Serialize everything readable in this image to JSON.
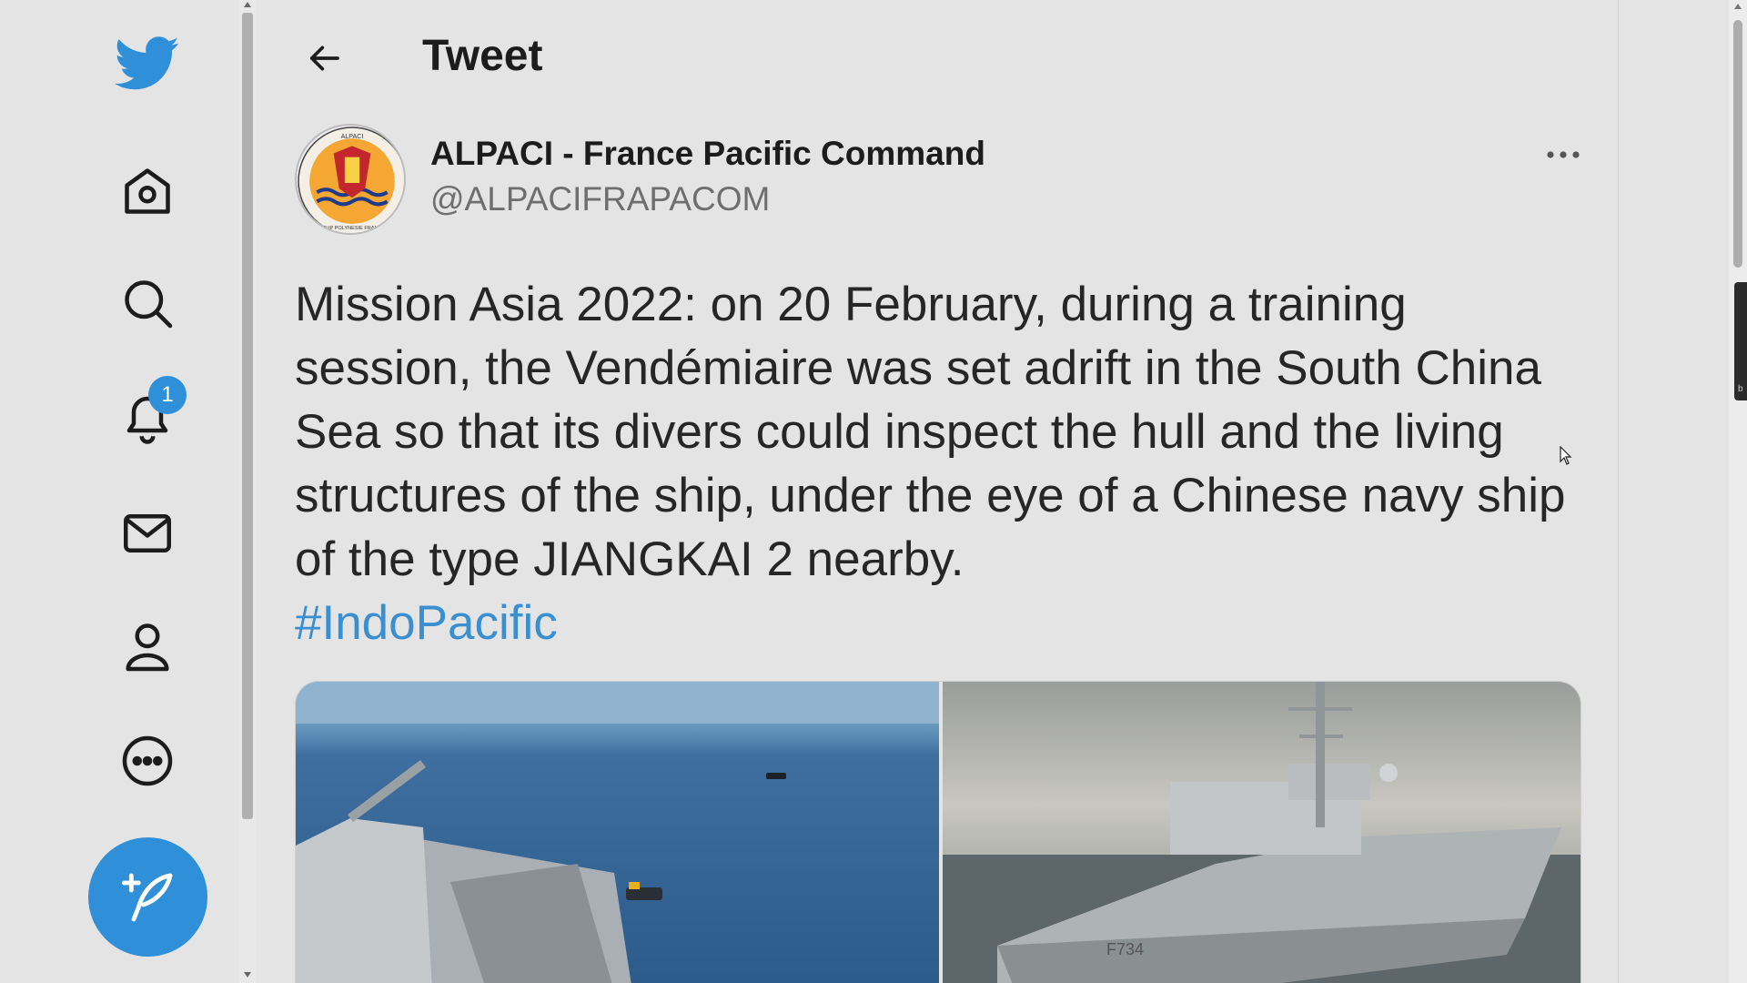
{
  "colors": {
    "accent": "#2f8fd8",
    "hashtag": "#3a8fd0",
    "background": "#e4e4e4"
  },
  "nav": {
    "items": [
      {
        "name": "twitter-logo",
        "icon": "twitter-bird-icon"
      },
      {
        "name": "home",
        "icon": "home-icon"
      },
      {
        "name": "explore",
        "icon": "search-icon"
      },
      {
        "name": "notifications",
        "icon": "bell-icon",
        "badge": "1"
      },
      {
        "name": "messages",
        "icon": "mail-icon"
      },
      {
        "name": "profile",
        "icon": "person-icon"
      },
      {
        "name": "more",
        "icon": "more-circle-icon"
      }
    ],
    "compose_icon": "feather-plus-icon"
  },
  "header": {
    "title": "Tweet",
    "back_icon": "arrow-left-icon"
  },
  "tweet": {
    "author": {
      "display_name": "ALPACI - France Pacific Command",
      "handle": "@ALPACIFRAPACOM",
      "avatar_text": "ALPACI",
      "avatar_motto": "COMSUP POLYNESIE FRANCAISE"
    },
    "more_icon": "ellipsis-icon",
    "text": "Mission Asia 2022: on 20 February, during a training session, the Vendémiaire was set adrift in the South China Sea so that its divers could inspect the hull and the living structures of the ship, under the eye of a Chinese navy ship of the type JIANGKAI 2 nearby.",
    "hashtag": "#IndoPacific",
    "media": {
      "photo_1_caption": "",
      "photo_2_hull_number": "F734"
    }
  },
  "scrollbar_tab_letter": "b"
}
